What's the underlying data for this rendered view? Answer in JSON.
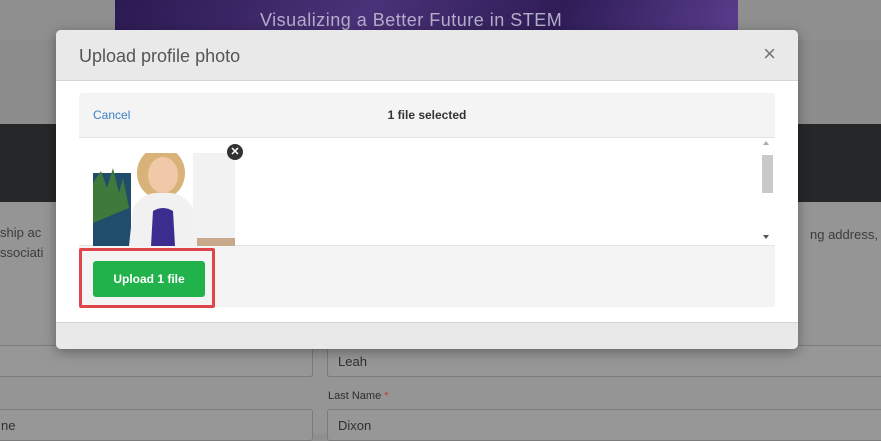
{
  "background": {
    "banner_text": "Visualizing a Better Future in STEM",
    "left_text_line1": "ship ac",
    "left_text_line2": "ssociati",
    "right_text": "ng address, c",
    "first_name_value": "Leah",
    "last_name_label": "Last Name",
    "required_mark": "*",
    "last_name_value": "Dixon",
    "left_field_text": "ne"
  },
  "modal": {
    "title": "Upload profile photo",
    "close_glyph": "×",
    "uploader": {
      "cancel_label": "Cancel",
      "status_text": "1 file selected",
      "remove_glyph": "✕",
      "upload_button_label": "Upload 1 file"
    }
  },
  "colors": {
    "upload_button": "#22b24c",
    "highlight_border": "#e0454b",
    "link": "#3b7fc4",
    "overlay": "#8f8f8f"
  }
}
